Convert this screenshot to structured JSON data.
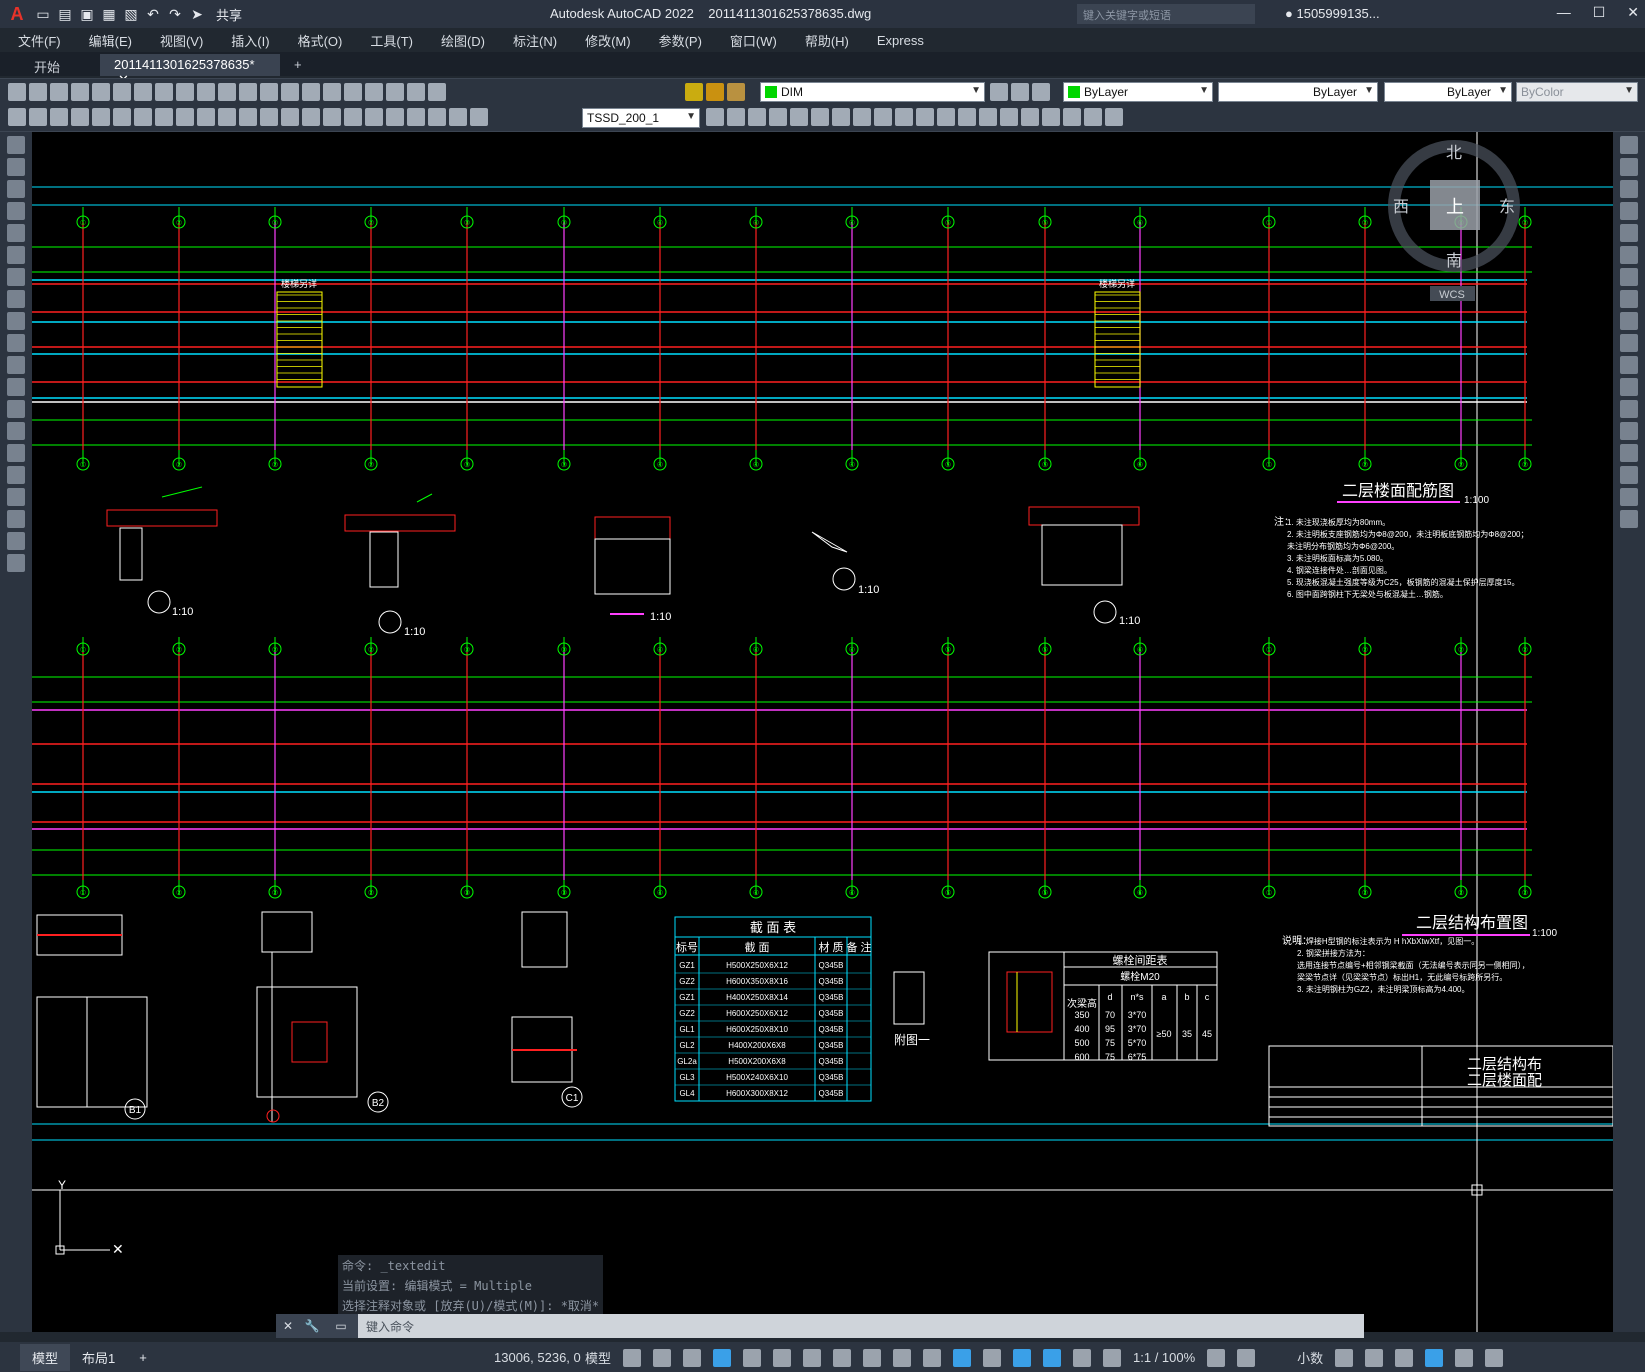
{
  "app": {
    "title": "Autodesk AutoCAD 2022",
    "filename": "20114113016253786​35.dwg",
    "share_label": "共享",
    "search_placeholder": "键入关键字或短语",
    "user": "1505999135...",
    "logo": "A"
  },
  "menu": [
    "文件(F)",
    "编辑(E)",
    "视图(V)",
    "插入(I)",
    "格式(O)",
    "工具(T)",
    "绘图(D)",
    "标注(N)",
    "修改(M)",
    "参数(P)",
    "窗口(W)",
    "帮助(H)",
    "Express"
  ],
  "doc_tabs": [
    {
      "label": "开始",
      "active": false
    },
    {
      "label": "20114113016253786​35*",
      "active": true
    }
  ],
  "toolbar": {
    "layer": "DIM",
    "color": "ByLayer",
    "linetype": "ByLayer",
    "lineweight": "ByLayer",
    "plotstyle": "ByColor",
    "dimstyle": "TSSD_200_1"
  },
  "viewcube": {
    "north": "北",
    "south": "南",
    "east": "东",
    "west": "西",
    "top": "上",
    "wcs": "WCS"
  },
  "drawing": {
    "axis_top": [
      "①",
      "②",
      "②",
      "②",
      "③",
      "③",
      "④",
      "④",
      "④",
      "⑤",
      "⑤",
      "⑥"
    ],
    "title1": "二层楼面配筋图",
    "title1_scale": "1:100",
    "title2": "二层结构布置图",
    "title2_scale": "1:100",
    "notes_title": "注：",
    "notes1": [
      "1. 未注现浇板厚均为80mm。",
      "2. 未注明板支座钢筋均为Φ8@200，未注明板底钢筋均为Φ8@200；",
      "   未注明分布钢筋均为Φ6@200。",
      "3. 未注明板面标高为5.080。",
      "4. 钢梁连接件处…剖面见图。",
      "5. 现浇板混凝土强度等级为C25，板钢筋的混凝土保护层厚度15。",
      "6. 图中面跨钢柱下无梁处与板混凝土…钢筋。"
    ],
    "section_labels": [
      "1:10",
      "1:10",
      "1:10",
      "1:10",
      "1:10"
    ],
    "stair_label": "楼梯另详",
    "section_table": {
      "title": "截 面 表",
      "headers": [
        "标号",
        "截 面",
        "材 质",
        "备 注"
      ],
      "rows": [
        [
          "GZ1",
          "H500X250X6X12",
          "Q345B",
          ""
        ],
        [
          "GZ2",
          "H600X350X8X16",
          "Q345B",
          ""
        ],
        [
          "GZ1",
          "H400X250X8X14",
          "Q345B",
          ""
        ],
        [
          "GZ2",
          "H600X250X6X12",
          "Q345B",
          ""
        ],
        [
          "GL1",
          "H600X250X8X10",
          "Q345B",
          ""
        ],
        [
          "GL2",
          "H400X200X6X8",
          "Q345B",
          ""
        ],
        [
          "GL2a",
          "H500X200X6X8",
          "Q345B",
          ""
        ],
        [
          "GL3",
          "H500X240X6X10",
          "Q345B",
          ""
        ],
        [
          "GL4",
          "H600X300X8X12",
          "Q345B",
          ""
        ]
      ]
    },
    "bolt_table": {
      "title": "螺栓间距表",
      "sub": "螺栓M20",
      "col_header": "次梁高",
      "cols": [
        "d",
        "n*s",
        "a",
        "b",
        "c"
      ],
      "rows": [
        [
          "350",
          "70",
          "3*70"
        ],
        [
          "400",
          "95",
          "3*70"
        ],
        [
          "500",
          "75",
          "5*70"
        ],
        [
          "600",
          "75",
          "6*75"
        ]
      ],
      "merged": [
        "≥50",
        "35",
        "45"
      ]
    },
    "note2_title": "说明：",
    "note2": [
      "1. 焊接H型钢的标注表示为 H hXbXtwXtf，见图一。",
      "2. 钢梁拼接方法为：",
      "   选用连接节点编号+相邻钢梁截面（无法编号表示同另一侧相同），",
      "   梁梁节点详（见梁梁节点）标出H1，无此编号标跨所另行。",
      "3. 未注明钢柱为GZ2，未注明梁顶标高为4.400。"
    ],
    "attached": "附图一",
    "titleblock1": "二层结构布",
    "titleblock2": "二层楼面配",
    "details": [
      "B1",
      "B2",
      "C1"
    ]
  },
  "command": {
    "lines": [
      "命令: _textedit",
      "当前设置: 编辑模式 = Multiple",
      "选择注释对象或 [放弃(U)/模式(M)]: *取消*"
    ],
    "placeholder": "键入命令"
  },
  "status": {
    "tabs": [
      "模型",
      "布局1"
    ],
    "coords": "13006, 5236, 0",
    "space": "模型",
    "scale": "1:1 / 100%",
    "units": "小数"
  },
  "colors": {
    "grid_green": "#00ff00",
    "beam_red": "#ff2020",
    "cyan": "#00e0ff",
    "magenta": "#ff40ff",
    "yellow": "#ffff00",
    "white": "#ffffff"
  }
}
